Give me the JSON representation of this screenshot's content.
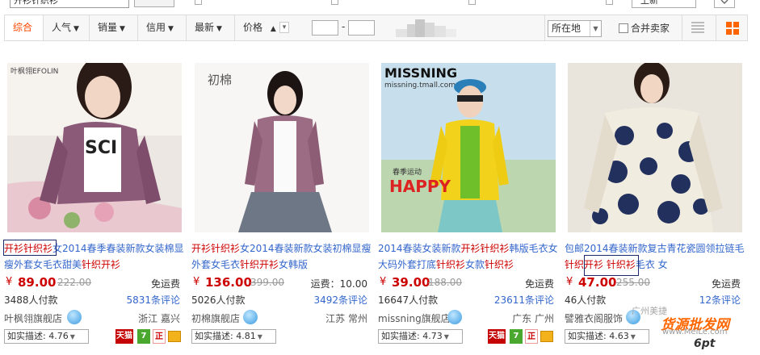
{
  "top": {
    "search_value": "开衫针织衫",
    "sort_value": "上新"
  },
  "toolbar": {
    "sorts": [
      "综合",
      "人气",
      "销量",
      "信用",
      "最新"
    ],
    "price_label": "价格",
    "price_dash": "-",
    "location_label": "所在地",
    "merge_label": "合并卖家"
  },
  "products": [
    {
      "title_parts": [
        {
          "t": "开衫针织衫",
          "hl": true
        },
        {
          "t": "女2014春季春装新款女装棉显瘦外套女毛衣甜美",
          "hl": false
        },
        {
          "t": "针织开衫",
          "hl": true
        }
      ],
      "currency": "¥",
      "price": "89.00",
      "old_price": "222.00",
      "shipping": "免运费",
      "paid": "3488人付款",
      "reviews": "5831条评论",
      "shop": "叶枫翎旗舰店",
      "location": "浙江 嘉兴",
      "desc": "如实描述: 4.76",
      "img_label": "叶枫翎EFOLIN",
      "img_text": "SCI"
    },
    {
      "title_parts": [
        {
          "t": "开衫针织衫",
          "hl": true
        },
        {
          "t": "女2014春装新款女装初棉显瘦外套女毛衣",
          "hl": false
        },
        {
          "t": "针织开衫",
          "hl": true
        },
        {
          "t": "女韩版",
          "hl": false
        }
      ],
      "currency": "¥",
      "price": "136.00",
      "old_price": "399.00",
      "shipping": "运费：10.00",
      "paid": "5026人付款",
      "reviews": "3492条评论",
      "shop": "初棉旗舰店",
      "location": "江苏 常州",
      "desc": "如实描述: 4.81",
      "img_label": "初棉"
    },
    {
      "title_parts": [
        {
          "t": "2014春装女装新款",
          "hl": false
        },
        {
          "t": "开衫针织衫",
          "hl": true
        },
        {
          "t": "韩版毛衣女大码外套打底",
          "hl": false
        },
        {
          "t": "针织衫",
          "hl": true
        },
        {
          "t": "女款",
          "hl": false
        },
        {
          "t": "针织衫",
          "hl": true
        }
      ],
      "currency": "¥",
      "price": "39.00",
      "old_price": "188.00",
      "shipping": "免运费",
      "paid": "16647人付款",
      "reviews": "23611条评论",
      "shop": "missning旗舰店",
      "location": "广东 广州",
      "desc": "如实描述: 4.73",
      "img_label": "MISSNING",
      "img_sub": "missning.tmall.com",
      "img_text": "HAPPY",
      "img_text2": "春季运动"
    },
    {
      "title_parts": [
        {
          "t": "包邮2014春装新款复古青花瓷圆领拉链毛",
          "hl": false
        },
        {
          "t": "针织开衫",
          "hl": true
        },
        {
          "t": " ",
          "hl": false
        },
        {
          "t": "针织衫",
          "hl": true
        },
        {
          "t": "毛衣 女",
          "hl": false
        }
      ],
      "currency": "¥",
      "price": "47.00",
      "old_price": "255.00",
      "shipping": "免运费",
      "paid": "46人付款",
      "reviews": "12条评论",
      "shop": "譬雅衣阁服饰",
      "location": "",
      "desc": "如实描述: 4.63"
    }
  ],
  "badges": {
    "tmall": "天猫",
    "seven": "7",
    "zheng": "正"
  },
  "watermark": {
    "brand": "货源批发网",
    "url": "www.MeiLe.com",
    "site": "6pt",
    "cn": "广州美捷"
  },
  "colors": {
    "accent": "#ff4400",
    "price": "#cc0000",
    "link": "#3366cc"
  }
}
